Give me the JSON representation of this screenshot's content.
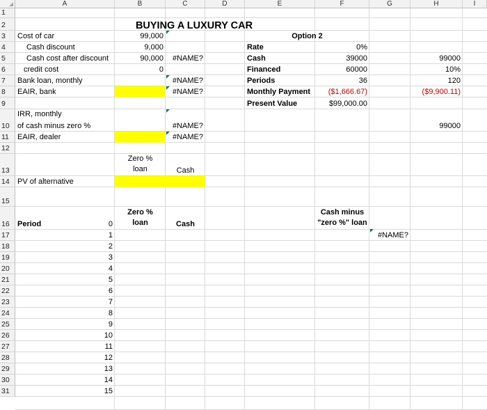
{
  "columns": [
    "A",
    "B",
    "C",
    "D",
    "E",
    "F",
    "G",
    "H",
    "I"
  ],
  "rows": [
    "1",
    "2",
    "3",
    "4",
    "5",
    "6",
    "7",
    "8",
    "9",
    "10",
    "11",
    "12",
    "13",
    "14",
    "15",
    "16",
    "17",
    "18",
    "19",
    "20",
    "21",
    "22",
    "23",
    "24",
    "25",
    "26",
    "27",
    "28",
    "29",
    "30",
    "31"
  ],
  "title": "BUYING A LUXURY CAR",
  "labels": {
    "cost_of_car": "Cost of car",
    "cash_discount": "Cash discount",
    "cash_cost_after_discount": "Cash cost after discount",
    "credit_cost": "credit cost",
    "bank_loan_monthly": "Bank loan, monthly",
    "eair_bank": "EAIR, bank",
    "irr_monthly_line1": "IRR, monthly",
    "irr_monthly_line2": "of cash minus zero %",
    "eair_dealer": "EAIR, dealer",
    "zero_loan_line1": "Zero %",
    "zero_loan_line2": "loan",
    "cash_small": "Cash",
    "pv_alternative": "PV of alternative",
    "period": "Period",
    "zero_loan_bold_line1": "Zero %",
    "zero_loan_bold_line2": "loan",
    "cash_bold": "Cash",
    "cash_minus_line1": "Cash minus",
    "cash_minus_line2": "\"zero %\" loan"
  },
  "values": {
    "b2": "99,000",
    "b3": "9,000",
    "b4": "90,000",
    "c4": "#NAME?",
    "b5": "0",
    "c6": "#NAME?",
    "c7": "#NAME?",
    "c9": "#NAME?",
    "c10": "#NAME?",
    "g16": "#NAME?"
  },
  "option2": {
    "header": "Option 2",
    "rate_label": "Rate",
    "rate": "0%",
    "cash_label": "Cash",
    "cash": "39000",
    "financed_label": "Financed",
    "financed": "60000",
    "periods_label": "Periods",
    "periods": "36",
    "monthly_label": "Monthly Payment",
    "monthly": "($1,666.67)",
    "pv_label": "Present Value",
    "pv": "$99,000.00"
  },
  "col_h": {
    "h4": "99000",
    "h5": "10%",
    "h6": "120",
    "h7": "($9,900.11)",
    "h9": "99000"
  },
  "periods": [
    "0",
    "1",
    "2",
    "3",
    "4",
    "5",
    "6",
    "7",
    "8",
    "9",
    "10",
    "11",
    "12",
    "13",
    "14",
    "15"
  ],
  "colors": {
    "highlight": "#ffff00",
    "negative": "#c00000",
    "header_bg": "#f2f2f2"
  }
}
